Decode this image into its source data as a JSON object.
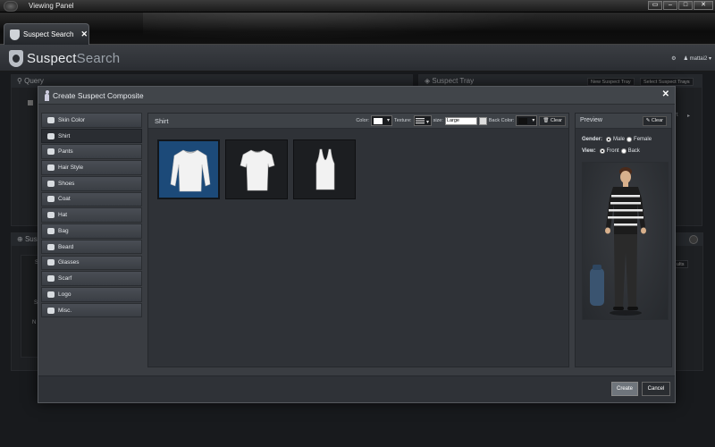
{
  "window": {
    "title": "Viewing Panel"
  },
  "doc_tab": {
    "label": "Suspect Search",
    "close": "✕"
  },
  "app": {
    "brand_left": "Suspect",
    "brand_right": "Search",
    "user": "mattai2"
  },
  "background": {
    "query_label": "Query",
    "tray_label": "Suspect Tray",
    "new_tray_label": "New Suspect Tray",
    "select_trays_label": "Select Suspect Trays",
    "results_label": "Sus",
    "results_sub": "S",
    "results_btn": "ults",
    "partial_r": "rt",
    "partial_n": "N",
    "partial_s": "S"
  },
  "modal": {
    "title": "Create Suspect Composite",
    "close": "✕",
    "categories": [
      {
        "label": "Skin Color",
        "icon": "person-icon"
      },
      {
        "label": "Shirt",
        "icon": "shirt-icon",
        "selected": true
      },
      {
        "label": "Pants",
        "icon": "pants-icon"
      },
      {
        "label": "Hair Style",
        "icon": "hair-icon"
      },
      {
        "label": "Shoes",
        "icon": "shoe-icon"
      },
      {
        "label": "Coat",
        "icon": "coat-icon"
      },
      {
        "label": "Hat",
        "icon": "hat-icon"
      },
      {
        "label": "Bag",
        "icon": "bag-icon"
      },
      {
        "label": "Beard",
        "icon": "beard-icon"
      },
      {
        "label": "Glasses",
        "icon": "glasses-icon"
      },
      {
        "label": "Scarf",
        "icon": "scarf-icon"
      },
      {
        "label": "Logo",
        "icon": "logo-icon"
      },
      {
        "label": "Misc.",
        "icon": "misc-icon"
      }
    ],
    "editor": {
      "title": "Shirt",
      "color_label": "Color:",
      "color_value": "#ffffff",
      "texture_label": "Texture:",
      "size_label": "size:",
      "size_value": "Large",
      "back_color_label": "Back Color:",
      "back_color_value": "#111111",
      "clear_label": "Clear",
      "items": [
        {
          "name": "long-sleeve-shirt",
          "selected": true
        },
        {
          "name": "t-shirt",
          "selected": false
        },
        {
          "name": "tank-top",
          "selected": false
        }
      ]
    },
    "preview": {
      "title": "Preview",
      "clear_label": "Clear",
      "gender_label": "Gender:",
      "gender_male": "Male",
      "gender_female": "Female",
      "gender_selected": "Male",
      "view_label": "View:",
      "view_front": "Front",
      "view_back": "Back",
      "view_selected": "Front"
    },
    "create_label": "Create",
    "cancel_label": "Cancel"
  },
  "colors": {
    "selected_tile": "#1c4a79",
    "panel": "#2f3237",
    "accent": "#6f757c"
  }
}
